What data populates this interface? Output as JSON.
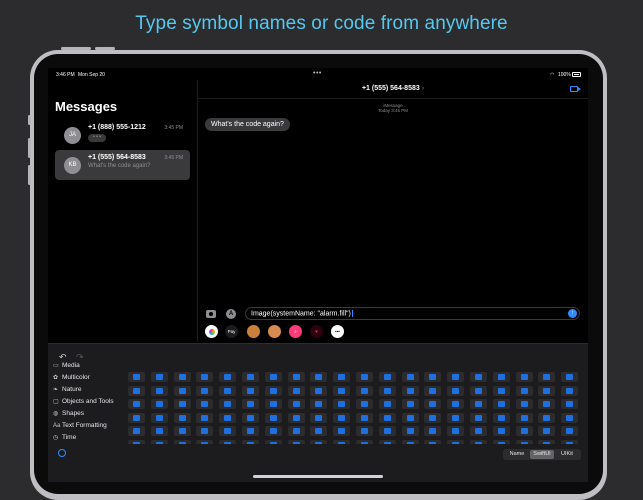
{
  "headline": "Type symbol names or code from anywhere",
  "status_bar": {
    "time": "3:46 PM",
    "date": "Mon Sep 20",
    "battery": "100%"
  },
  "sidebar": {
    "title": "Messages",
    "conversations": [
      {
        "initials": "JA",
        "name": "+1 (888) 555-1212",
        "time": "3:45 PM",
        "preview": "• • •"
      },
      {
        "initials": "KB",
        "name": "+1 (555) 564-8583",
        "time": "3:45 PM",
        "preview": "What's the code again?"
      }
    ]
  },
  "chat": {
    "contact": "+1 (555) 564-8583",
    "service_label": "iMessage",
    "timestamp": "Today 3:45 PM",
    "message": "What's the code again?",
    "input_value": "Image(systemName: \"alarm.fill\")"
  },
  "app_strip": [
    {
      "label": "",
      "color": "#ffffff"
    },
    {
      "label": "Pay",
      "color": "#1c1c1e"
    },
    {
      "label": "",
      "color": "#c8803a"
    },
    {
      "label": "",
      "color": "#d98a50"
    },
    {
      "label": "",
      "color": "#ff3b7a"
    },
    {
      "label": "",
      "color": "#ff2d55"
    },
    {
      "label": "•••",
      "color": "#ffffff"
    }
  ],
  "categories": [
    {
      "icon": "▭",
      "label": "Media"
    },
    {
      "icon": "✿",
      "label": "Multicolor"
    },
    {
      "icon": "❧",
      "label": "Nature"
    },
    {
      "icon": "▢",
      "label": "Objects and Tools"
    },
    {
      "icon": "◍",
      "label": "Shapes"
    },
    {
      "icon": "Aa",
      "label": "Text Formatting"
    },
    {
      "icon": "◷",
      "label": "Time"
    }
  ],
  "segments": [
    "Name",
    "SwiftUI",
    "UIKit"
  ],
  "active_segment": "SwiftUI",
  "colors": {
    "headline": "#55c8f0",
    "accent": "#2f8cff",
    "symbol": "#1e6fe0"
  }
}
